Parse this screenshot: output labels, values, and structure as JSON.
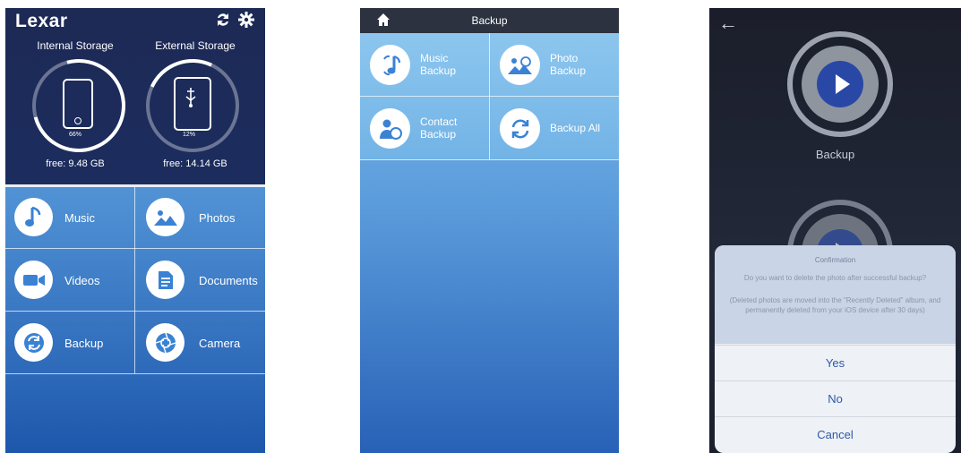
{
  "home": {
    "logo": "Lexar",
    "icons": [
      "sync-icon",
      "gear-icon"
    ],
    "internal": {
      "label": "Internal Storage",
      "percent_text": "66%",
      "percent": 66,
      "free": "free: 9.48 GB"
    },
    "external": {
      "label": "External Storage",
      "percent_text": "12%",
      "percent": 12,
      "free": "free: 14.14 GB"
    },
    "tiles": [
      {
        "label": "Music",
        "icon": "music-note-icon"
      },
      {
        "label": "Photos",
        "icon": "photos-icon"
      },
      {
        "label": "Videos",
        "icon": "video-camera-icon"
      },
      {
        "label": "Documents",
        "icon": "document-icon"
      },
      {
        "label": "Backup",
        "icon": "backup-icon"
      },
      {
        "label": "Camera",
        "icon": "camera-shutter-icon"
      }
    ]
  },
  "backup": {
    "title": "Backup",
    "items": [
      {
        "label_line1": "Music",
        "label_line2": "Backup",
        "icon": "music-backup-icon"
      },
      {
        "label_line1": "Photo",
        "label_line2": "Backup",
        "icon": "photo-backup-icon"
      },
      {
        "label_line1": "Contact",
        "label_line2": "Backup",
        "icon": "contact-backup-icon"
      },
      {
        "label_line1": "Backup All",
        "label_line2": "",
        "icon": "backup-all-icon"
      }
    ]
  },
  "confirm": {
    "background_label": "Backup",
    "dialog_title": "Confirmation",
    "question": "Do you want to delete the photo after successful backup?",
    "note": "(Deleted photos are moved into the \"Recently Deleted\" album, and permanently deleted from your iOS device after 30 days)",
    "buttons": [
      "Yes",
      "No",
      "Cancel"
    ]
  },
  "colors": {
    "header_navy": "#1d2a55",
    "tile_blue": "#5a9bdb",
    "play_blue": "#2948a6",
    "action_text": "#2e5aa8"
  }
}
